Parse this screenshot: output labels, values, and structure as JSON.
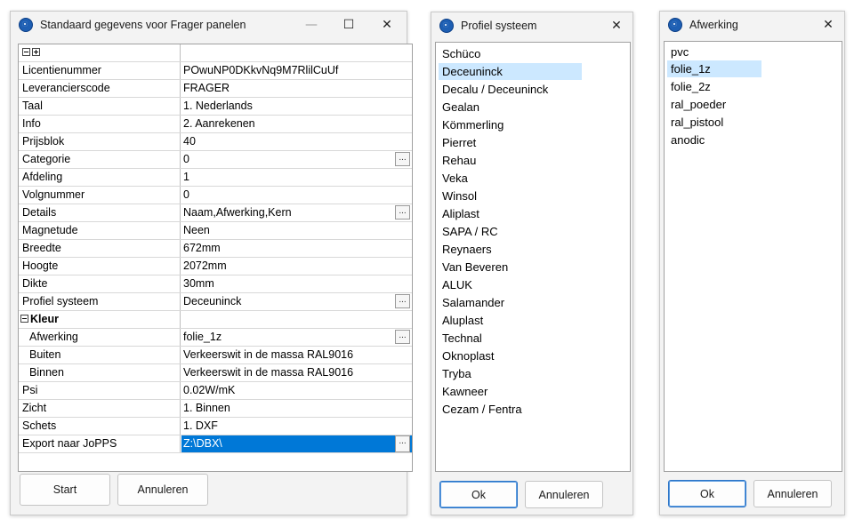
{
  "window1": {
    "title": "Standaard gegevens voor Frager panelen",
    "controls": {
      "minimize": "—",
      "maximize": "☐",
      "close": "✕"
    },
    "grid": {
      "rows": [
        {
          "name": "Licentienummer",
          "value": "POwuNP0DKkvNq9M7RlilCuUf"
        },
        {
          "name": "Leverancierscode",
          "value": "FRAGER"
        },
        {
          "name": "Taal",
          "value": "1. Nederlands"
        },
        {
          "name": "Info",
          "value": "2. Aanrekenen"
        },
        {
          "name": "Prijsblok",
          "value": "40"
        },
        {
          "name": "Categorie",
          "value": "0"
        },
        {
          "name": "Afdeling",
          "value": "1"
        },
        {
          "name": "Volgnummer",
          "value": "0"
        },
        {
          "name": "Details",
          "value": "Naam,Afwerking,Kern"
        },
        {
          "name": "Magnetude",
          "value": "Neen"
        },
        {
          "name": "Breedte",
          "value": "672mm"
        },
        {
          "name": "Hoogte",
          "value": "2072mm"
        },
        {
          "name": "Dikte",
          "value": "30mm"
        },
        {
          "name": "Profiel systeem",
          "value": "Deceuninck"
        },
        {
          "name": "Kleur",
          "value": ""
        },
        {
          "name": "Afwerking",
          "value": "folie_1z"
        },
        {
          "name": "Buiten",
          "value": "Verkeerswit in de massa RAL9016"
        },
        {
          "name": "Binnen",
          "value": "Verkeerswit in de massa RAL9016"
        },
        {
          "name": "Psi",
          "value": "0.02W/mK"
        },
        {
          "name": "Zicht",
          "value": "1. Binnen"
        },
        {
          "name": "Schets",
          "value": "1. DXF"
        },
        {
          "name": "Export naar JoPPS",
          "value": "Z:\\DBX\\"
        }
      ],
      "ellipsis": "..."
    },
    "buttons": {
      "start": "Start",
      "cancel": "Annuleren"
    }
  },
  "window2": {
    "title": "Profiel systeem",
    "close": "✕",
    "items": [
      "Schüco",
      "Deceuninck",
      "Decalu / Deceuninck",
      "Gealan",
      "Kömmerling",
      "Pierret",
      "Rehau",
      "Veka",
      "Winsol",
      "Aliplast",
      "SAPA / RC",
      "Reynaers",
      "Van Beveren",
      "ALUK",
      "Salamander",
      "Aluplast",
      "Technal",
      "Oknoplast",
      "Tryba",
      "Kawneer",
      "Cezam / Fentra"
    ],
    "selected": "Deceuninck",
    "buttons": {
      "ok": "Ok",
      "cancel": "Annuleren"
    }
  },
  "window3": {
    "title": "Afwerking",
    "close": "✕",
    "items": [
      "pvc",
      "folie_1z",
      "folie_2z",
      "ral_poeder",
      "ral_pistool",
      "anodic"
    ],
    "selected": "folie_1z",
    "buttons": {
      "ok": "Ok",
      "cancel": "Annuleren"
    }
  },
  "colors": {
    "selection_blue": "#0078d7",
    "list_highlight": "#cce8ff",
    "app_icon": "#1e5fb3"
  },
  "icons": [
    "app-icon",
    "minimize-icon",
    "maximize-icon",
    "close-icon",
    "expand-icon",
    "collapse-icon",
    "ellipsis-icon"
  ]
}
